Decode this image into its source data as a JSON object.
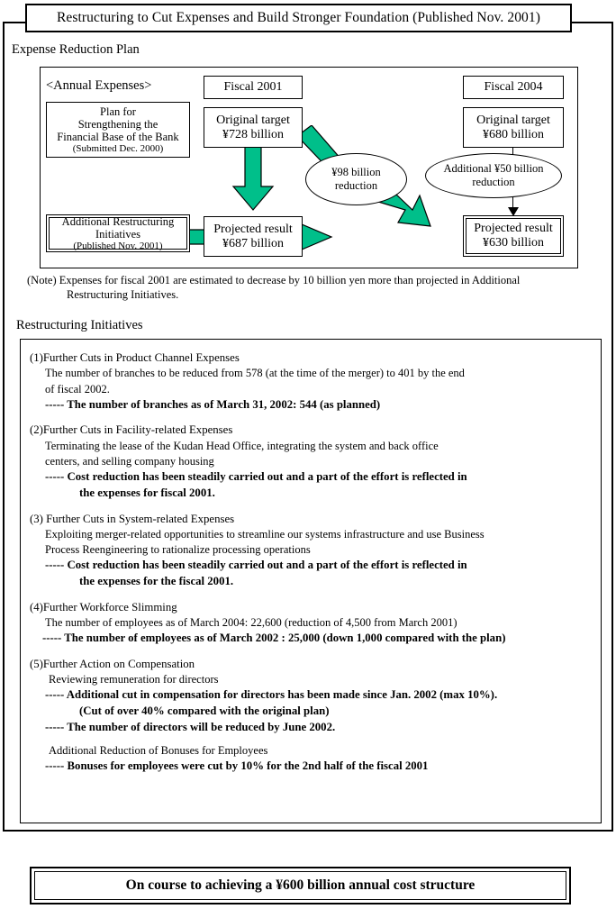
{
  "title": "Restructuring to Cut Expenses and Build Stronger Foundation (Published Nov. 2001)",
  "sections": {
    "expense_plan_heading": "Expense Reduction Plan",
    "restructuring_heading": "Restructuring Initiatives"
  },
  "diagram": {
    "annual_expenses_label": "<Annual Expenses>",
    "plan_box": {
      "line1": "Plan for",
      "line2": "Strengthening the",
      "line3": "Financial Base of the Bank",
      "line4": "(Submitted Dec. 2000)"
    },
    "additional_box": {
      "line1": "Additional Restructuring",
      "line2": "Initiatives",
      "line3": "(Published Nov. 2001)"
    },
    "fiscal2001": {
      "header": "Fiscal 2001",
      "original_target_line1": "Original target",
      "original_target_line2": "¥728 billion",
      "projected_line1": "Projected result",
      "projected_line2": "¥687 billion"
    },
    "fiscal2004": {
      "header": "Fiscal 2004",
      "original_target_line1": "Original target",
      "original_target_line2": "¥680 billion",
      "projected_line1": "Projected result",
      "projected_line2": "¥630 billion"
    },
    "ellipse_98": {
      "line1": "¥98 billion",
      "line2": "reduction"
    },
    "ellipse_50": {
      "line1": "Additional ¥50 billion",
      "line2": "reduction"
    },
    "arrow_color": "#00BF8A"
  },
  "note": {
    "line1": "(Note) Expenses for fiscal 2001 are estimated to decrease by 10 billion yen more than projected in Additional",
    "line2": "Restructuring Initiatives."
  },
  "initiatives": [
    {
      "title": "(1)Further Cuts in Product Channel Expenses",
      "body_line1": "The number of branches to be reduced from 578 (at the time of the merger) to 401 by the end",
      "body_line2": "of fiscal 2002.",
      "bold_line1": "----- The number of branches as of March 31, 2002: 544 (as planned)",
      "bold_line2": ""
    },
    {
      "title": "(2)Further Cuts in Facility-related Expenses",
      "body_line1": "Terminating the lease of the Kudan Head Office, integrating the system and back office",
      "body_line2": "centers, and selling company housing",
      "bold_line1": "----- Cost reduction has been steadily carried out and a part of the effort is reflected  in",
      "bold_line2": "the expenses for fiscal 2001."
    },
    {
      "title": "(3) Further Cuts in System-related Expenses",
      "body_line1": "Exploiting merger-related opportunities to streamline our systems infrastructure and use Business",
      "body_line2": "Process Reengineering to rationalize processing operations",
      "bold_line1": "----- Cost reduction has been steadily carried out and a part of the effort is reflected in",
      "bold_line2": "the expenses for the fiscal 2001."
    },
    {
      "title": "(4)Further Workforce Slimming",
      "body_line1": "The number of employees as of March 2004: 22,600 (reduction of 4,500 from March 2001)",
      "body_line2": "",
      "bold_line1": "----- The number of employees as of March 2002 : 25,000 (down 1,000 compared with the plan)",
      "bold_line2": ""
    }
  ],
  "initiative5": {
    "title": "(5)Further Action on Compensation",
    "body_line1": "Reviewing remuneration for directors",
    "bold_line1": "----- Additional cut in compensation for directors has been made since Jan. 2002 (max 10%).",
    "bold_line1_cont": "(Cut of over 40% compared with the original plan)",
    "bold_line2": "----- The number of directors will be reduced by June 2002.",
    "sub_title": "Additional Reduction of Bonuses for Employees",
    "sub_bold": "----- Bonuses for employees were cut by 10% for the 2nd half of the fiscal 2001"
  },
  "footer": "On course to achieving a ¥600 billion annual cost structure"
}
